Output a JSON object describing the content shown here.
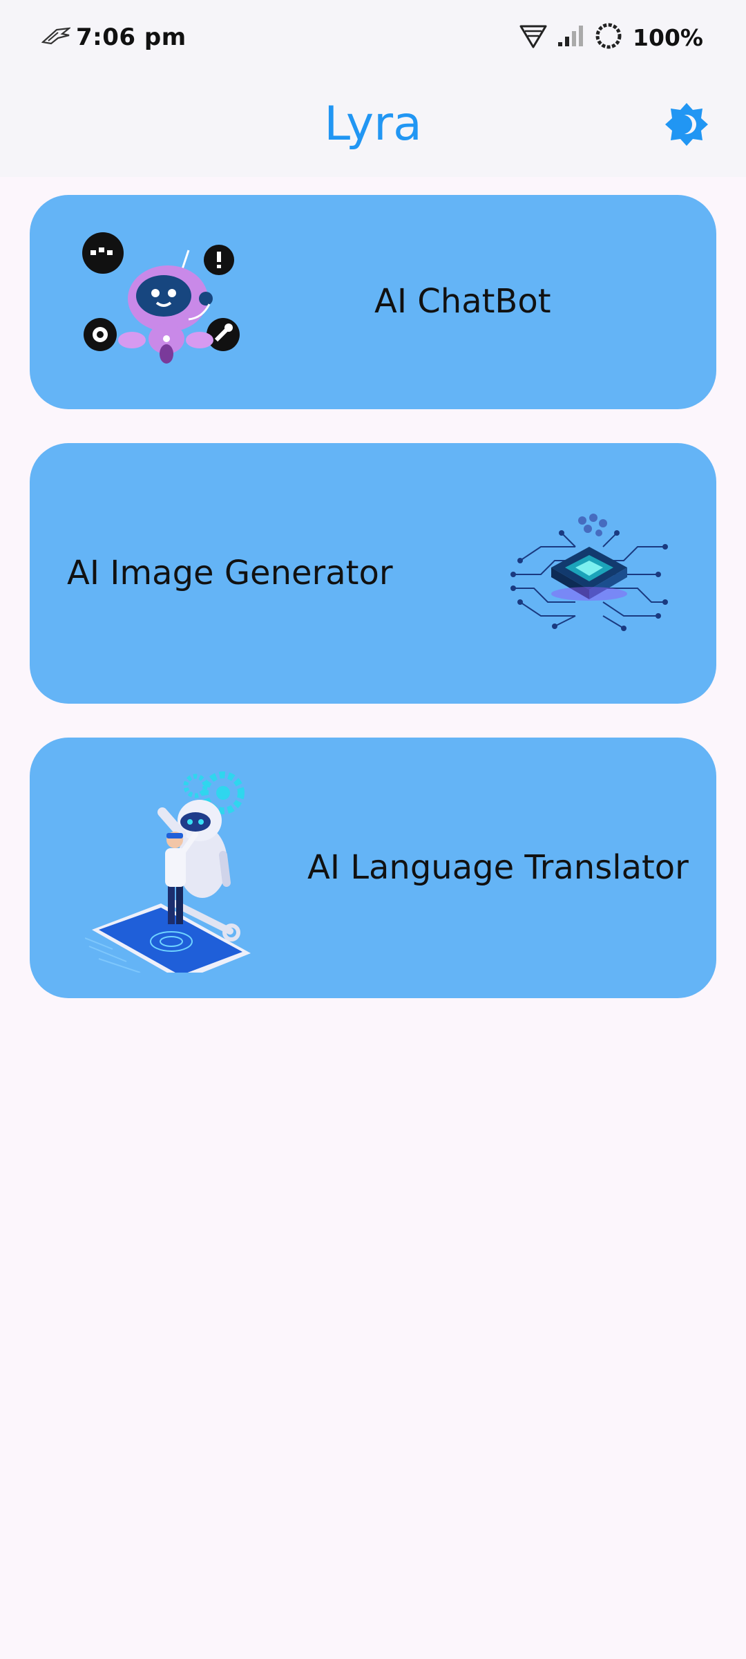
{
  "status_bar": {
    "time": "7:06 pm",
    "battery": "100%",
    "icons": [
      "rog-logo-icon",
      "wifi-icon",
      "signal-icon",
      "data-saver-icon"
    ]
  },
  "app_bar": {
    "title": "Lyra",
    "theme_toggle_icon": "theme-toggle-icon"
  },
  "cards": [
    {
      "label": "AI ChatBot",
      "illustration": "chatbot-robot-illustration"
    },
    {
      "label": "AI Image Generator",
      "illustration": "circuit-chip-illustration"
    },
    {
      "label": "AI Language Translator",
      "illustration": "translator-robot-phone-illustration"
    }
  ],
  "colors": {
    "accent": "#2196f3",
    "card_background": "#64b4f6",
    "page_background": "#fcf6fc",
    "app_bar_background": "#f6f5f9"
  }
}
